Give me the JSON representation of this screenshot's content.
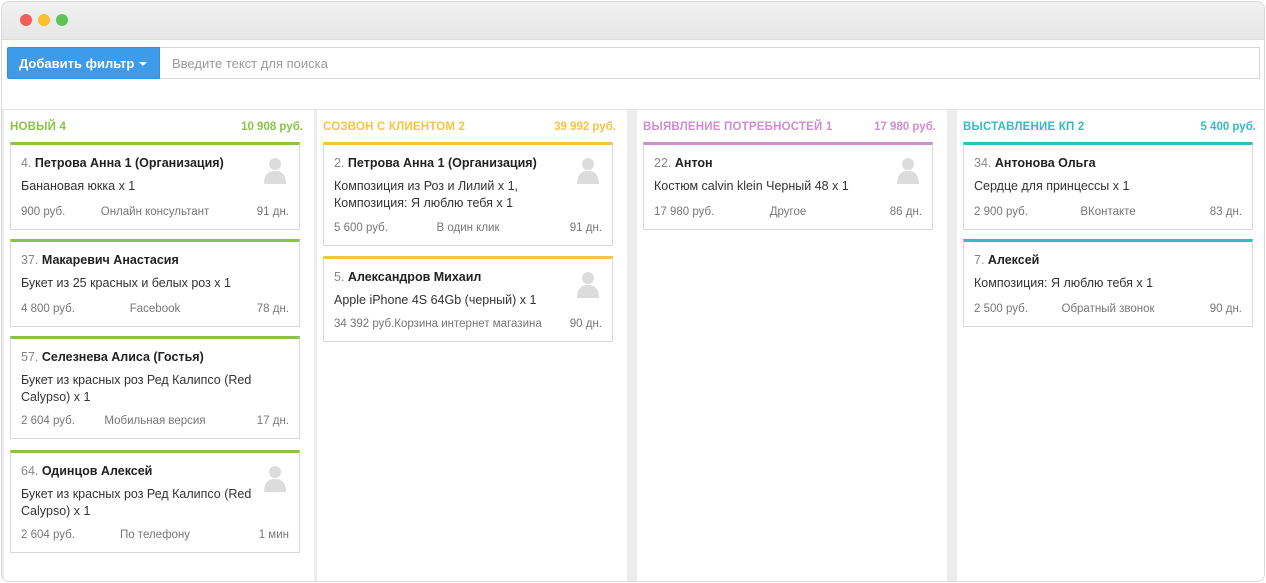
{
  "window": {
    "controls": [
      "close",
      "minimize",
      "maximize"
    ]
  },
  "toolbar": {
    "filter_button": "Добавить фильтр",
    "search_placeholder": "Введите текст для поиска"
  },
  "columns": [
    {
      "title": "Новый 4",
      "sum": "10 908 руб.",
      "color": "#8bc34a",
      "cards": [
        {
          "id": "4.",
          "name": "Петрова Анна 1 (Организация)",
          "product": "Банановая юкка x 1",
          "price": "900 руб.",
          "source": "Онлайн консультант",
          "days": "91 дн.",
          "avatar": "user-avatar-icon"
        },
        {
          "id": "37.",
          "name": "Макаревич Анастасия",
          "product": "Букет из 25 красных и белых роз x 1",
          "price": "4 800 руб.",
          "source": "Facebook",
          "days": "78 дн."
        },
        {
          "id": "57.",
          "name": "Селезнева Алиса (Гостья)",
          "product": "Букет из красных роз Ред Калипсо (Red Calypso) x 1",
          "price": "2 604 руб.",
          "source": "Мобильная версия",
          "days": "17 дн."
        },
        {
          "id": "64.",
          "name": "Одинцов Алексей",
          "product": "Букет из красных роз Ред Калипсо (Red Calypso) x 1",
          "price": "2 604 руб.",
          "source": "По телефону",
          "days": "1 мин",
          "avatar": "user-avatar-icon"
        }
      ]
    },
    {
      "title": "Созвон с клиентом 2",
      "sum": "39 992 руб.",
      "color": "#f5c443",
      "cards": [
        {
          "id": "2.",
          "name": "Петрова Анна 1 (Организация)",
          "product": "Композиция из Роз и Лилий x 1, Композиция: Я люблю тебя x 1",
          "price": "5 600 руб.",
          "source": "В один клик",
          "days": "91 дн.",
          "avatar": "user-avatar-icon"
        },
        {
          "id": "5.",
          "name": "Александров Михаил",
          "product": "Apple iPhone 4S 64Gb (черный) x 1",
          "price": "34 392 руб.",
          "source": "Корзина интернет магазина",
          "days": "90 дн.",
          "avatar": "user-avatar-icon"
        }
      ]
    },
    {
      "title": "Выявление потребностей 1",
      "sum": "17 980 руб.",
      "color": "#cf8ed0",
      "cards": [
        {
          "id": "22.",
          "name": "Антон",
          "product": "Костюм calvin klein Черный 48 x 1",
          "price": "17 980 руб.",
          "source": "Другое",
          "days": "86 дн.",
          "avatar": "user-avatar-icon"
        }
      ]
    },
    {
      "title": "Выставление КП 2",
      "sum": "5 400 руб.",
      "color": "#35bcc3",
      "cards": [
        {
          "id": "34.",
          "name": "Антонова Ольга",
          "product": "Сердце для принцессы x 1",
          "price": "2 900 руб.",
          "source": "ВКонтакте",
          "days": "83 дн."
        },
        {
          "id": "7.",
          "name": "Алексей",
          "product": "Композиция: Я люблю тебя x 1",
          "price": "2 500 руб.",
          "source": "Обратный звонок",
          "days": "90 дн."
        }
      ]
    }
  ]
}
